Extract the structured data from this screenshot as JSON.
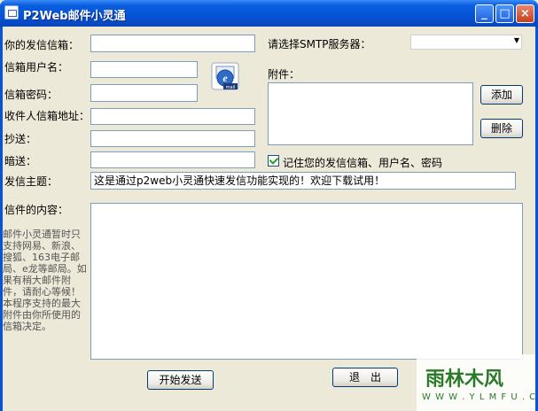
{
  "window": {
    "title": "P2Web邮件小灵通",
    "minimize": "_",
    "maximize": "□",
    "close": "×"
  },
  "form": {
    "sender_email_label": "你的发信信箱：",
    "username_label": "信箱用户名：",
    "password_label": "信箱密码：",
    "recipient_label": "收件人信箱地址：",
    "cc_label": "抄送：",
    "bcc_label": "暗送：",
    "subject_label": "发信主题：",
    "subject_value": "这是通过p2web小灵通快速发信功能实现的！欢迎下载试用！",
    "content_label": "信件的内容：",
    "smtp_label": "请选择SMTP服务器：",
    "smtp_value": "",
    "attachment_label": "附件：",
    "remember_label": "记住您的发信信箱、用户名、密码",
    "remember_checked": true,
    "side_note": "邮件小灵通暂时只支持网易、新浪、搜狐、163电子邮局、e龙等邮局。如果有稍大邮件附件，请耐心等候！本程序支持的最大附件由你所使用的信箱决定。"
  },
  "buttons": {
    "add": "添加",
    "delete": "删除",
    "send": "开始发送",
    "exit": "退　出"
  },
  "icons": {
    "mail_badge": "mail",
    "mail_letter": "e"
  },
  "watermark": {
    "main": "雨林木风",
    "url": "W W W . Y L M F U . C O M"
  },
  "colors": {
    "titlebar": "#0653D8",
    "window_bg": "#ECE9D8",
    "input_border": "#7F9DB9"
  }
}
